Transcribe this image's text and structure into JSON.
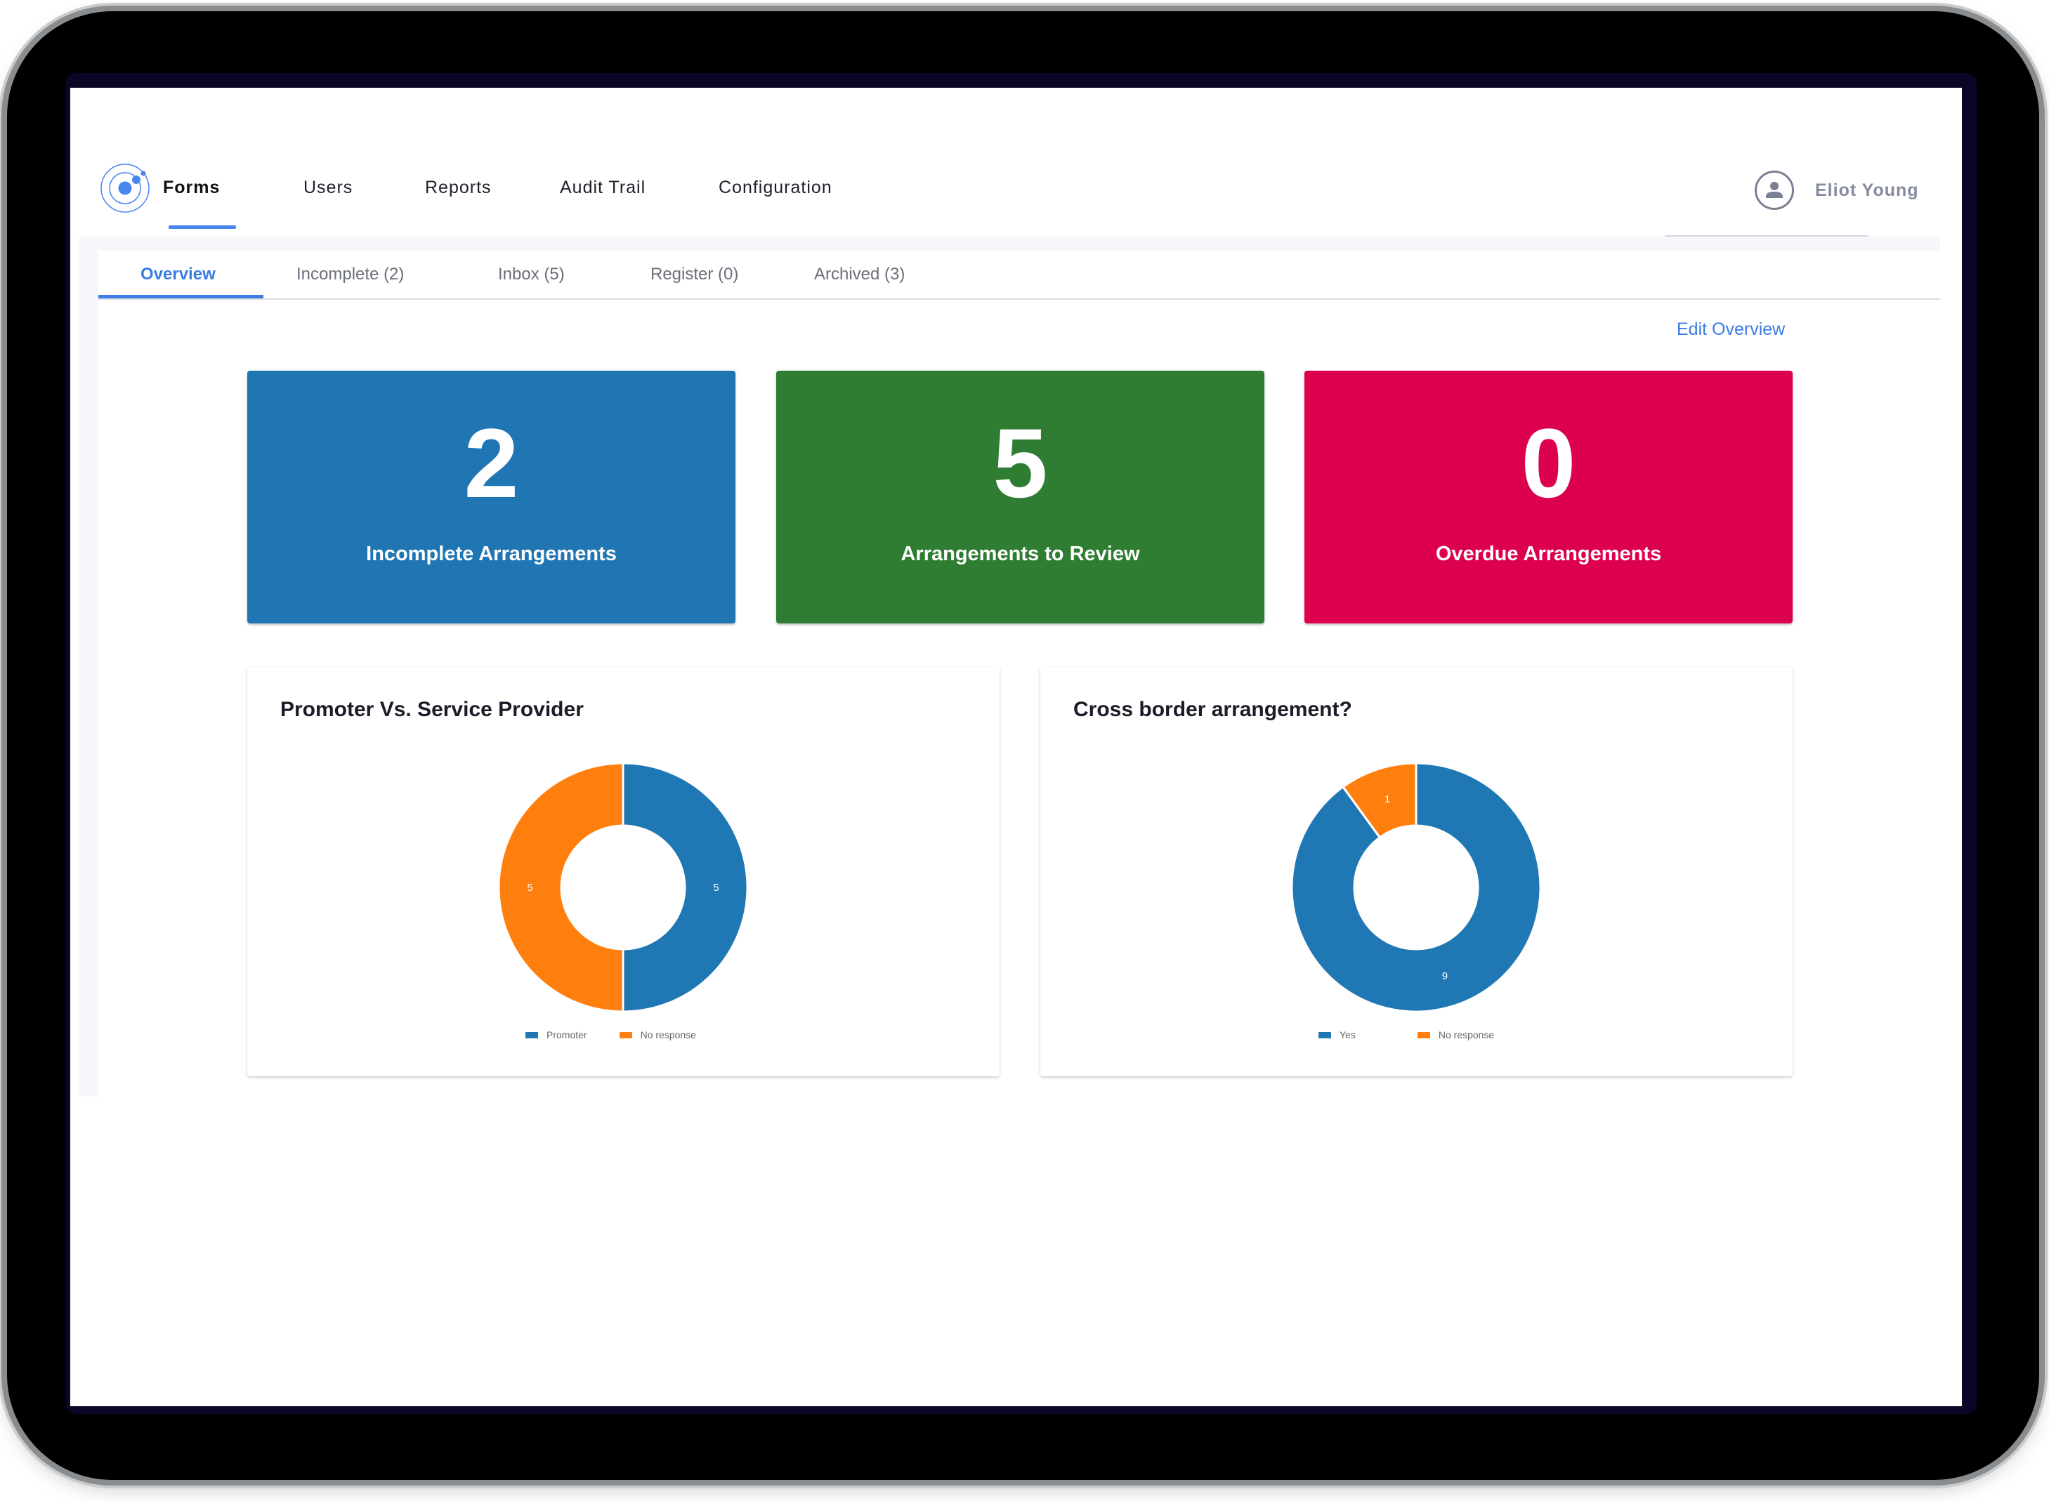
{
  "nav": {
    "logo": "ionic-logo-icon",
    "items": [
      {
        "label": "Forms",
        "active": true
      },
      {
        "label": "Users",
        "active": false
      },
      {
        "label": "Reports",
        "active": false
      },
      {
        "label": "Audit Trail",
        "active": false
      },
      {
        "label": "Configuration",
        "active": false
      }
    ],
    "user": {
      "name": "Eliot Young",
      "icon": "user-avatar-icon"
    }
  },
  "tabs": [
    {
      "label": "Overview",
      "active": true
    },
    {
      "label": "Incomplete (2)",
      "active": false
    },
    {
      "label": "Inbox (5)",
      "active": false
    },
    {
      "label": "Register (0)",
      "active": false
    },
    {
      "label": "Archived (3)",
      "active": false
    }
  ],
  "edit_overview_label": "Edit Overview",
  "stats": [
    {
      "value": "2",
      "label": "Incomplete Arrangements",
      "color": "#2076b3"
    },
    {
      "value": "5",
      "label": "Arrangements to Review",
      "color": "#2f7d32"
    },
    {
      "value": "0",
      "label": "Overdue Arrangements",
      "color": "#dc004e"
    }
  ],
  "colors": {
    "accent": "#3c7be3",
    "series_blue": "#1f77b4",
    "series_orange": "#ff7f0e"
  },
  "chart_data": [
    {
      "type": "pie",
      "donut": true,
      "title": "Promoter Vs. Service Provider",
      "categories": [
        "Promoter",
        "No response"
      ],
      "values": [
        5,
        5
      ],
      "colors": [
        "#1f77b4",
        "#ff7f0e"
      ],
      "data_labels": [
        "5",
        "5"
      ],
      "legend": "bottom"
    },
    {
      "type": "pie",
      "donut": true,
      "title": "Cross border arrangement?",
      "categories": [
        "Yes",
        "No response"
      ],
      "values": [
        9,
        1
      ],
      "colors": [
        "#1f77b4",
        "#ff7f0e"
      ],
      "data_labels": [
        "9",
        "1"
      ],
      "legend": "bottom"
    }
  ]
}
